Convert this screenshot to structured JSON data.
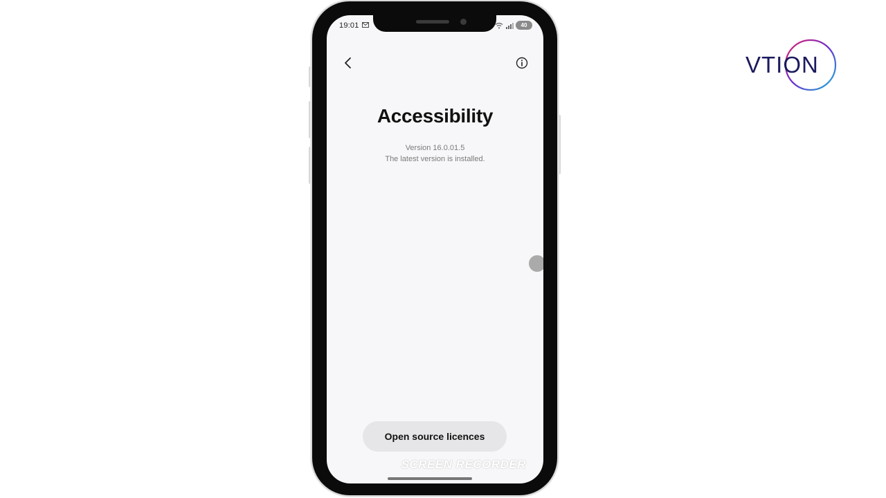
{
  "status_bar": {
    "time": "19:01",
    "battery": "40"
  },
  "header": {
    "back_icon": "chevron-left-icon",
    "info_icon": "info-icon"
  },
  "page": {
    "title": "Accessibility",
    "version": "Version 16.0.01.5",
    "version_status": "The latest version is installed."
  },
  "actions": {
    "open_source_label": "Open source licences"
  },
  "overlay": {
    "watermark": "SCREEN RECORDER"
  },
  "branding": {
    "logo_text": "VTION",
    "logo_colors": [
      "#1b1a5e",
      "#e2246a",
      "#6a2bd0",
      "#18b8d8"
    ]
  }
}
